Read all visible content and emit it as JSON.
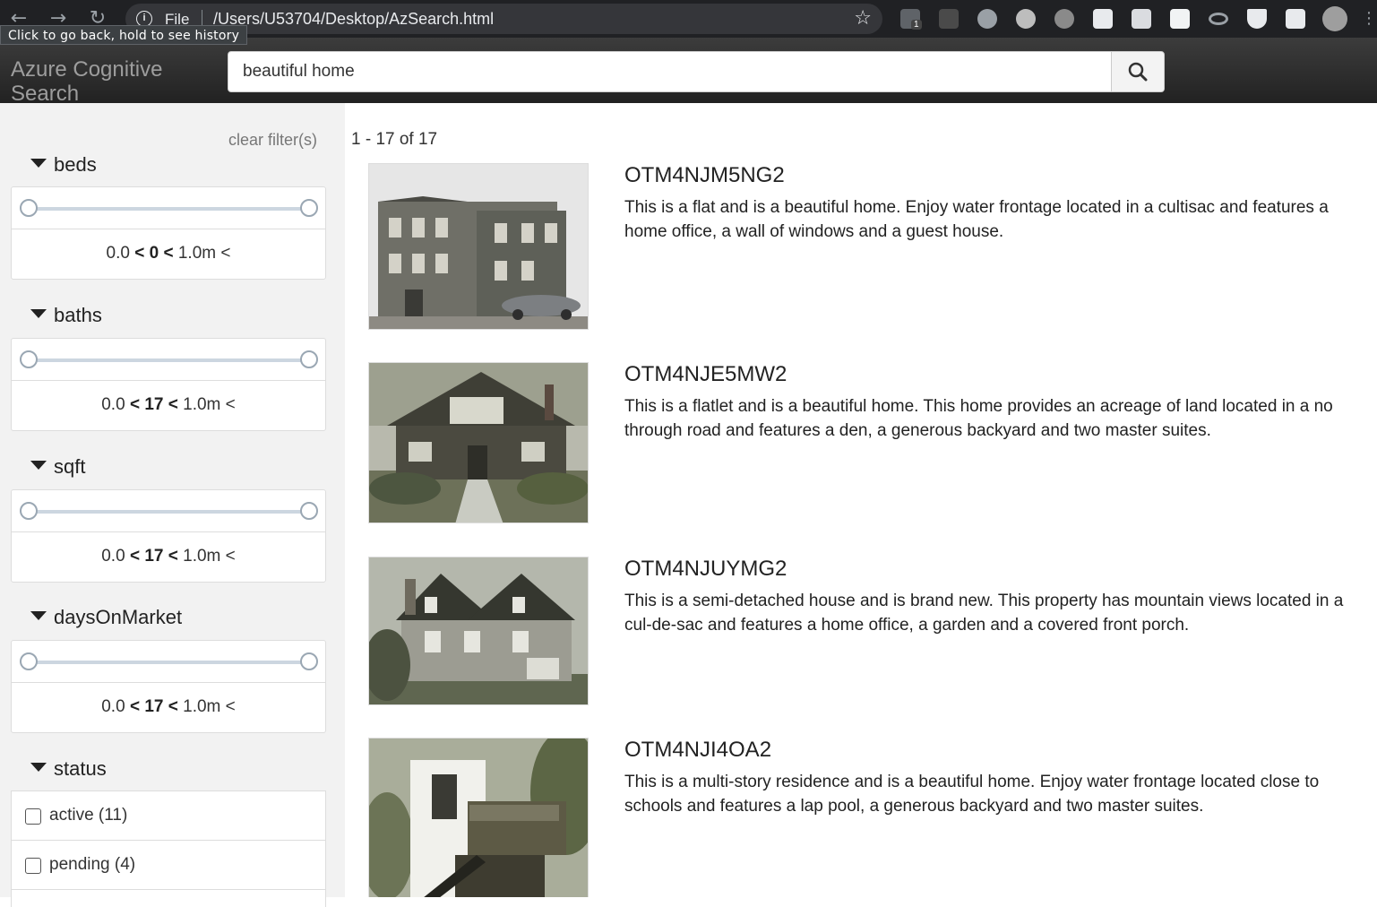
{
  "browser": {
    "file_label": "File",
    "url": "/Users/U53704/Desktop/AzSearch.html",
    "tooltip": "Click to go back, hold to see history",
    "ext_badge": "1",
    "icons": [
      "back-arrow-icon",
      "forward-arrow-icon",
      "reload-icon",
      "info-icon",
      "star-icon",
      "extensions-puzzle-icon",
      "profile-avatar"
    ]
  },
  "header": {
    "brand": "Azure Cognitive Search",
    "search_value": "beautiful home"
  },
  "sidebar": {
    "clear_label": "clear filter(s)",
    "facets": [
      {
        "name": "beds",
        "min": "0.0",
        "value": "0",
        "max": "1.0m"
      },
      {
        "name": "baths",
        "min": "0.0",
        "value": "17",
        "max": "1.0m"
      },
      {
        "name": "sqft",
        "min": "0.0",
        "value": "17",
        "max": "1.0m"
      },
      {
        "name": "daysOnMarket",
        "min": "0.0",
        "value": "17",
        "max": "1.0m"
      }
    ],
    "status": {
      "name": "status",
      "options": [
        {
          "label": "active (11)",
          "checked": false
        },
        {
          "label": "pending (4)",
          "checked": false
        }
      ]
    }
  },
  "results": {
    "count_label": "1 - 17 of 17",
    "items": [
      {
        "id": "OTM4NJM5NG2",
        "desc": "This is a flat and is a beautiful home. Enjoy water frontage located in a cultisac and features a home office, a wall of windows and a guest house."
      },
      {
        "id": "OTM4NJE5MW2",
        "desc": "This is a flatlet and is a beautiful home. This home provides an acreage of land located in a no through road and features a den, a generous backyard and two master suites."
      },
      {
        "id": "OTM4NJUYMG2",
        "desc": "This is a semi-detached house and is brand new. This property has mountain views located in a cul-de-sac and features a home office, a garden and a covered front porch."
      },
      {
        "id": "OTM4NJI4OA2",
        "desc": "This is a multi-story residence and is a beautiful home. Enjoy water frontage located close to schools and features a lap pool, a generous backyard and two master suites."
      }
    ]
  }
}
